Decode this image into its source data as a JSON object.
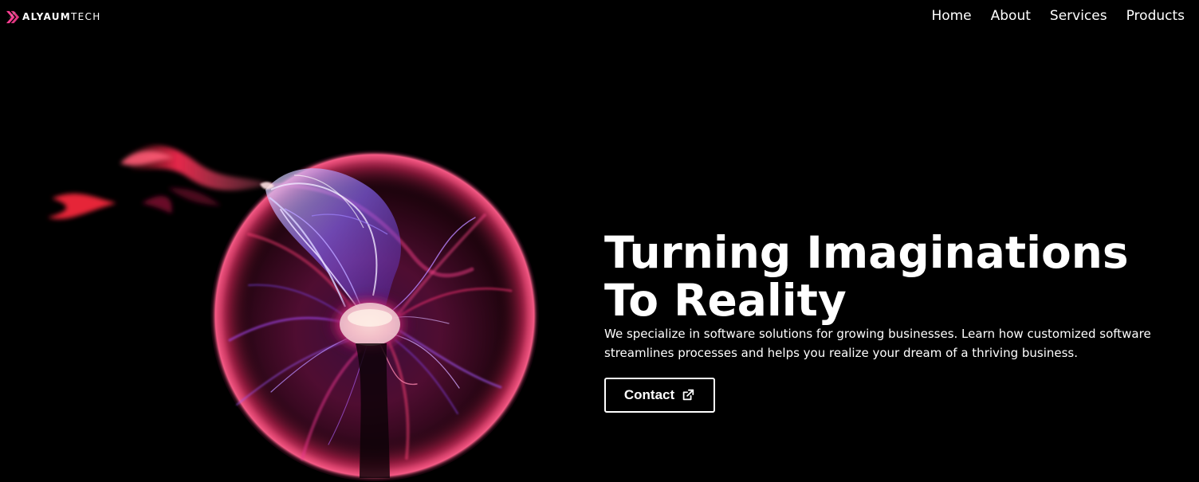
{
  "brand": {
    "logo_icon": "stylized-x-logo-icon",
    "name_primary": "ALYAUM",
    "name_secondary": "TECH",
    "accent_color": "#ff3f93"
  },
  "nav": {
    "items": [
      {
        "label": "Home"
      },
      {
        "label": "About"
      },
      {
        "label": "Services"
      },
      {
        "label": "Products"
      }
    ]
  },
  "hero": {
    "title": "Turning Imaginations To Reality",
    "subtitle": "We specialize in software solutions for growing businesses. Learn how customized software streamlines processes and helps you realize your dream of a thriving business.",
    "contact_label": "Contact",
    "contact_icon": "external-link-icon"
  },
  "colors": {
    "background": "#000000",
    "text": "#ffffff",
    "plasma_pink": "#ff2f6a",
    "plasma_violet": "#8f68ff"
  }
}
